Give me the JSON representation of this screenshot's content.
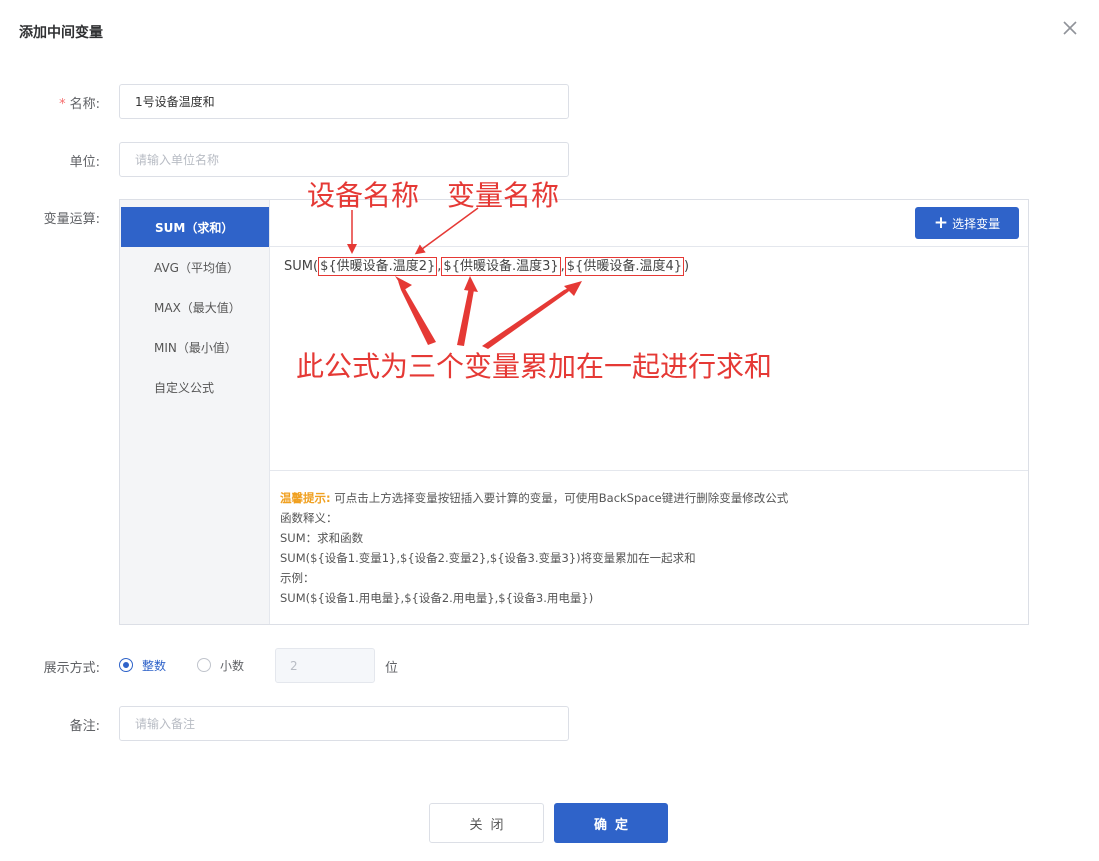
{
  "dialog": {
    "title": "添加中间变量"
  },
  "form": {
    "name": {
      "required_mark": "*",
      "label": "名称:",
      "value": "1号设备温度和"
    },
    "unit": {
      "label": "单位:",
      "placeholder": "请输入单位名称"
    },
    "operation": {
      "label": "变量运算:",
      "items": [
        {
          "label": "SUM（求和）",
          "active": true
        },
        {
          "label": "AVG（平均值）",
          "active": false
        },
        {
          "label": "MAX（最大值）",
          "active": false
        },
        {
          "label": "MIN（最小值）",
          "active": false
        },
        {
          "label": "自定义公式",
          "active": false
        }
      ],
      "select_button": "选择变量",
      "formula": {
        "prefix": "SUM(",
        "vars": [
          "${供暖设备.温度2}",
          "${供暖设备.温度3}",
          "${供暖设备.温度4}"
        ],
        "separator": ",",
        "suffix": ")"
      },
      "hint": {
        "title": "温馨提示:",
        "text": "可点击上方选择变量按钮插入要计算的变量，可使用BackSpace键进行删除变量修改公式",
        "lines": [
          "函数释义：",
          "SUM：求和函数",
          "SUM(${设备1.变量1},${设备2.变量2},${设备3.变量3})将变量累加在一起求和",
          "示例：",
          "SUM(${设备1.用电量},${设备2.用电量},${设备3.用电量})"
        ]
      }
    },
    "display": {
      "label": "展示方式:",
      "options": [
        {
          "label": "整数",
          "checked": true
        },
        {
          "label": "小数",
          "checked": false
        }
      ],
      "decimal_value": "2",
      "decimal_unit": "位"
    },
    "remark": {
      "label": "备注:",
      "placeholder": "请输入备注"
    }
  },
  "annotations": {
    "device_name": "设备名称",
    "variable_name": "变量名称",
    "explanation": "此公式为三个变量累加在一起进行求和",
    "color": "#e53935"
  },
  "buttons": {
    "close": "关闭",
    "confirm": "确定"
  },
  "colors": {
    "primary": "#2f63c9",
    "required": "#f56c6c",
    "hint_title": "#f0a020"
  }
}
